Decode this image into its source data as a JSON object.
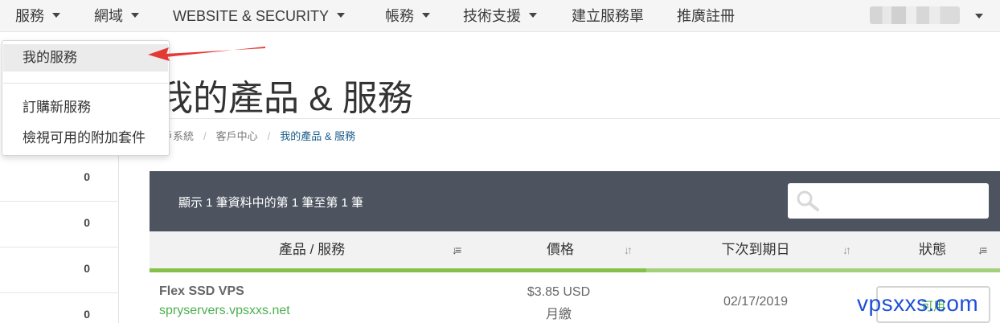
{
  "nav": {
    "items": [
      {
        "label": "服務",
        "has_caret": true
      },
      {
        "label": "網域",
        "has_caret": true
      },
      {
        "label": "WEBSITE & SECURITY",
        "has_caret": true
      },
      {
        "label": "帳務",
        "has_caret": true
      },
      {
        "label": "技術支援",
        "has_caret": true
      },
      {
        "label": "建立服務單",
        "has_caret": false
      },
      {
        "label": "推廣註冊",
        "has_caret": false
      }
    ]
  },
  "dropdown": {
    "items": [
      "我的服務",
      "訂購新服務",
      "檢視可用的附加套件"
    ],
    "active_index": 0
  },
  "sidebar": {
    "counts": [
      "0",
      "0",
      "0",
      "0"
    ]
  },
  "page": {
    "title": "我的產品 & 服務"
  },
  "breadcrumb": {
    "items": [
      "戶系統",
      "客戶中心"
    ],
    "current": "我的產品 & 服務"
  },
  "table": {
    "info": "顯示 1 筆資料中的第 1 筆至第 1 筆",
    "search_placeholder": "",
    "columns": [
      "產品 / 服務",
      "價格",
      "下次到期日",
      "狀態"
    ],
    "rows": [
      {
        "product": "Flex SSD VPS",
        "domain": "spryservers.vpsxxs.net",
        "price": "$3.85 USD",
        "cycle": "月繳",
        "due": "02/17/2019",
        "status": "可用"
      }
    ]
  },
  "watermark": "vpsxxs.com",
  "colors": {
    "accent_green": "#84c04a",
    "link_green": "#4caf50",
    "panel_dark": "#4d5460",
    "arrow_red": "#e53935",
    "watermark_blue": "#1f4fd6"
  }
}
